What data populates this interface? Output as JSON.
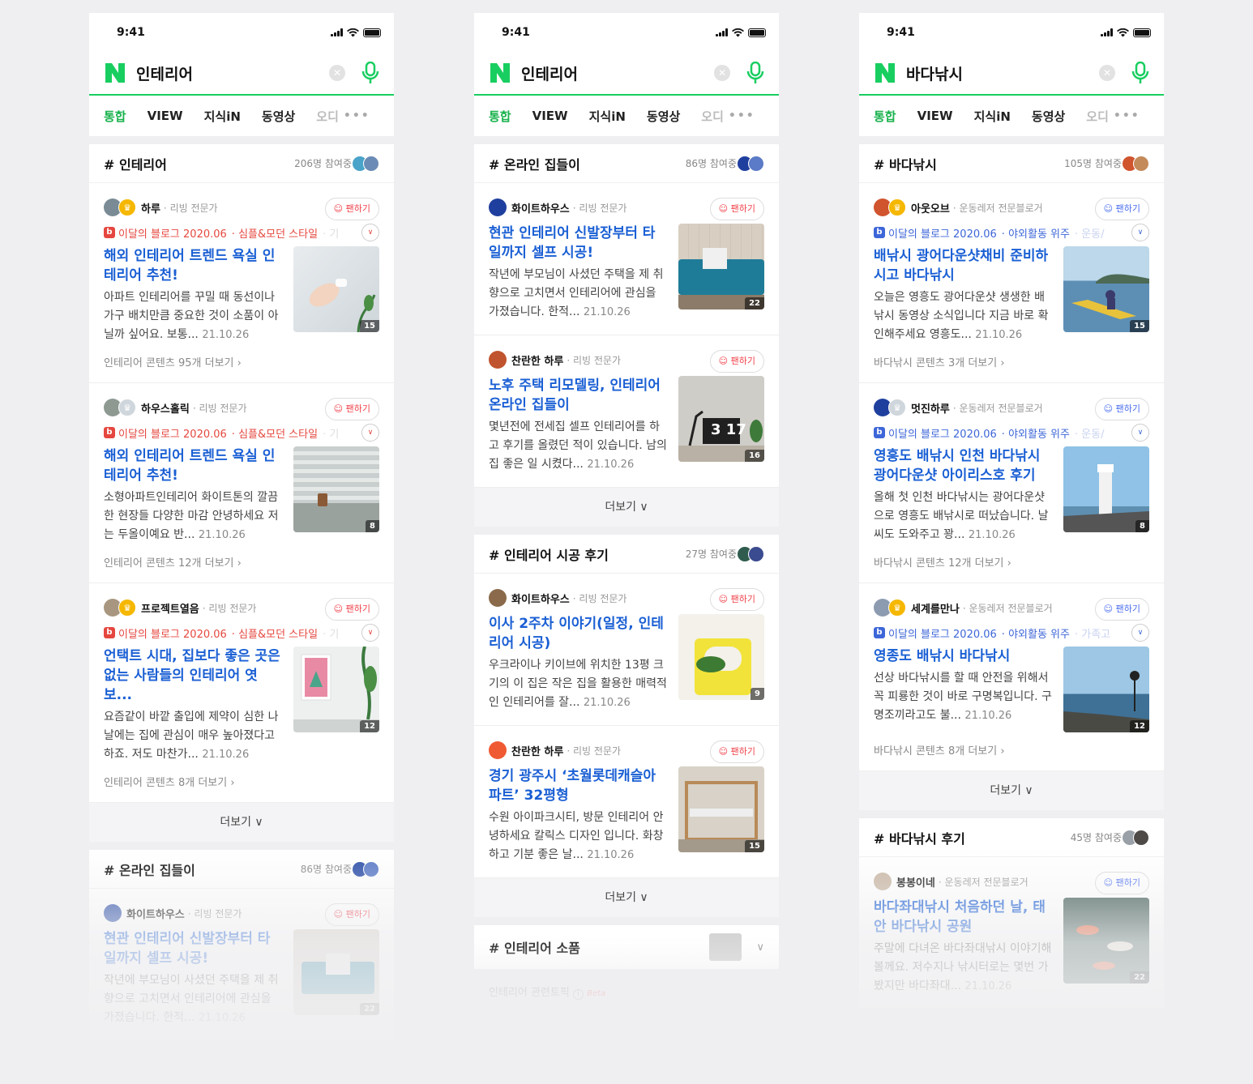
{
  "status_time": "9:41",
  "tabs": {
    "t1": "통합",
    "t2": "VIEW",
    "t3": "지식iN",
    "t4": "동영상",
    "t5": "오디",
    "more": "•••"
  },
  "common": {
    "fan": "팬하기",
    "more_btn": "더보기",
    "clear": "✕",
    "chev": "∨",
    "sep": "·"
  },
  "phone1": {
    "query": "인테리어",
    "sec1": {
      "title": "# 인테리어",
      "count": "206명 참여중",
      "posts": [
        {
          "name": "하루",
          "role": "리빙 전문가",
          "badge": "이달의 블로그 2020.06",
          "tag": "심플&모던 스타일",
          "tag2": "· 기",
          "title": "해외 인테리어 트렌드 욕실 인테리어 추천!",
          "desc": "아파트 인테리어를 꾸밀 때 동선이나 가구 배치만큼 중요한 것이 소품이 아닐까 싶어요. 보통...",
          "date": "21.10.26",
          "count": "15",
          "more": "인테리어 콘텐츠 95개 더보기 ›"
        },
        {
          "name": "하우스홀릭",
          "role": "리빙 전문가",
          "badge": "이달의 블로그 2020.06",
          "tag": "심플&모던 스타일",
          "tag2": "· 기",
          "title": "해외 인테리어 트렌드 욕실 인테리어 추천!",
          "desc": "소형아파트인테리어 화이트톤의 깔끔한 현장들 다양한 마감 안녕하세요 저는 두올이예요 반...",
          "date": "21.10.26",
          "count": "8",
          "more": "인테리어 콘텐츠 12개 더보기 ›"
        },
        {
          "name": "프로젝트열음",
          "role": "리빙 전문가",
          "badge": "이달의 블로그 2020.06",
          "tag": "심플&모던 스타일",
          "tag2": "· 기",
          "title": "언택트 시대, 집보다 좋은 곳은 없는 사람들의 인테리어 엿보...",
          "desc": "요즘같이 바깥 출입에 제약이 심한 나날에는 집에 관심이 매우 높아졌다고 하죠. 저도 마찬가...",
          "date": "21.10.26",
          "count": "12",
          "more": "인테리어 콘텐츠 8개 더보기 ›"
        }
      ]
    },
    "sec2": {
      "title": "# 온라인 집들이",
      "count": "86명 참여중",
      "posts": [
        {
          "name": "화이트하우스",
          "role": "리빙 전문가",
          "title": "현관 인테리어 신발장부터 타일까지 셀프 시공!",
          "desc": "작년에 부모님이 사셨던 주택을 제 취향으로 고치면서 인테리어에 관심을 가졌습니다. 한적...",
          "date": "21.10.26",
          "count": "22"
        }
      ]
    }
  },
  "phone2": {
    "query": "인테리어",
    "sec1": {
      "title": "# 온라인 집들이",
      "count": "86명 참여중",
      "posts": [
        {
          "name": "화이트하우스",
          "role": "리빙 전문가",
          "title": "현관 인테리어 신발장부터 타일까지 셀프 시공!",
          "desc": "작년에 부모님이 사셨던 주택을 제 취향으로 고치면서 인테리어에 관심을 가졌습니다. 한적...",
          "date": "21.10.26",
          "count": "22"
        },
        {
          "name": "찬란한 하루",
          "role": "리빙 전문가",
          "title": "노후 주택 리모델링, 인테리어 온라인 집들이",
          "desc": "몇년전에 전세집 셀프 인테리어를 하고 후기를 올렸던 적이 있습니다. 남의집 좋은 일 시켰다...",
          "date": "21.10.26",
          "count": "16",
          "clock": "3 17"
        }
      ]
    },
    "sec2": {
      "title": "# 인테리어 시공 후기",
      "count": "27명 참여중",
      "posts": [
        {
          "name": "화이트하우스",
          "role": "리빙 전문가",
          "title": "이사 2주차 이야기(일정, 인테리어 시공)",
          "desc": "우크라이나 키이브에 위치한 13평 크기의 이 집은 작은 집을 활용한 매력적인 인테리어를 잘...",
          "date": "21.10.26",
          "count": "9"
        },
        {
          "name": "찬란한 하루",
          "role": "리빙 전문가",
          "title": "경기 광주시 ‘초월롯데캐슬아파트’ 32평형",
          "desc": "수원 아이파크시티, 방문 인테리어 안녕하세요 칼릭스 디자인 입니다. 화창하고 기분 좋은 날...",
          "date": "21.10.26",
          "count": "15"
        }
      ]
    },
    "topic": {
      "title": "# 인테리어 소품",
      "sub": "인테리어 관련토픽",
      "beta": "Beta"
    }
  },
  "phone3": {
    "query": "바다낚시",
    "sec1": {
      "title": "# 바다낚시",
      "count": "105명 참여중",
      "posts": [
        {
          "name": "아웃오브",
          "role": "운동레저 전문블로거",
          "badge": "이달의 블로그 2020.06",
          "tag": "야외활동 위주",
          "tag2": "· 운동/",
          "title": "배낚시 광어다운샷채비 준비하시고 바다낚시",
          "desc": "오늘은 영흥도 광어다운샷 생생한 배낚시 동영상 소식입니다 지금 바로 확인해주세요 영흥도...",
          "date": "21.10.26",
          "count": "15",
          "more": "바다낚시 콘텐츠 3개 더보기 ›"
        },
        {
          "name": "멋진하루",
          "role": "운동레저 전문블로거",
          "badge": "이달의 블로그 2020.06",
          "tag": "야외활동 위주",
          "tag2": "· 운동/",
          "title": "영흥도 배낚시 인천 바다낚시 광어다운샷 아이리스호 후기",
          "desc": "올해 첫 인천 바다낚시는 광어다운샷으로 영흥도 배낚시로 떠났습니다. 날씨도 도와주고 꽝...",
          "date": "21.10.26",
          "count": "8",
          "more": "바다낚시 콘텐츠 12개 더보기 ›"
        },
        {
          "name": "세계를만나",
          "role": "운동레저 전문블로거",
          "badge": "이달의 블로그 2020.06",
          "tag": "야외활동 위주",
          "tag2": "· 가족고",
          "title": "영종도 배낚시 바다낚시",
          "desc": "선상 바다낚시를 할 때 안전을 위해서 꼭 피룡한 것이 바로 구명복입니다. 구명조끼라고도 불...",
          "date": "21.10.26",
          "count": "12",
          "more": "바다낚시 콘텐츠 8개 더보기 ›"
        }
      ]
    },
    "sec2": {
      "title": "# 바다낚시 후기",
      "count": "45명 참여중",
      "posts": [
        {
          "name": "봉봉이네",
          "role": "운동레저 전문블로거",
          "title": "바다좌대낚시 처음하던 날, 태안 바다낚시 공원",
          "desc": "주말에 다녀온 바다좌대낚시 이야기해볼께요. 저수지나 낚시터로는 몇번 가봤지만 바다좌대...",
          "date": "21.10.26",
          "count": "22"
        }
      ]
    }
  },
  "colors": {
    "naver_green": "#19ce60",
    "link_blue": "#1a5fd4",
    "badge_red": "#e5473f",
    "badge_blue": "#3d66d8"
  }
}
